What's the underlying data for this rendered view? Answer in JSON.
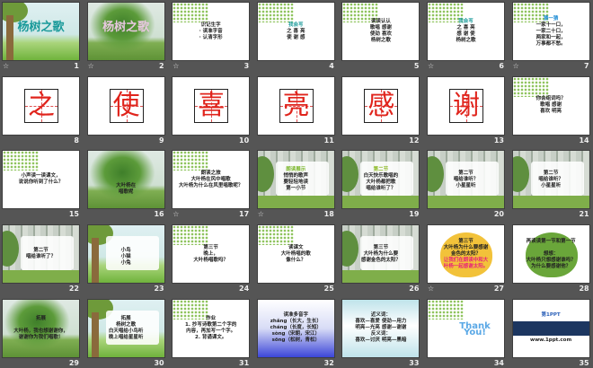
{
  "view": "slide-sorter",
  "slides": [
    {
      "number": "1",
      "theme": "meadow",
      "anim": true,
      "lines": [
        "杨树之歌"
      ],
      "accent": "#1a9a9a"
    },
    {
      "number": "2",
      "theme": "photo",
      "anim": true,
      "lines": [
        "杨树之歌"
      ],
      "accent": "#e8c8e0"
    },
    {
      "number": "3",
      "theme": "vines",
      "anim": true,
      "lines": [
        "识记生字",
        "· 读准字音",
        "· 认清字形"
      ]
    },
    {
      "number": "4",
      "theme": "vines",
      "anim": false,
      "lines": [
        "我会写",
        "之 喜 亮",
        "使 谢 感"
      ],
      "accent": "#1a9a9a"
    },
    {
      "number": "5",
      "theme": "vines",
      "anim": false,
      "lines": [
        "读读认认",
        "歌唱 感谢",
        "使劲 喜欢",
        "杨树之歌"
      ]
    },
    {
      "number": "6",
      "theme": "vines",
      "anim": true,
      "lines": [
        "我会写",
        "之 喜 亮",
        "感 谢 使",
        "杨树之歌"
      ],
      "accent": "#1a9a9a"
    },
    {
      "number": "7",
      "theme": "vines",
      "anim": true,
      "lines": [
        "猜一猜",
        "一家十一口，",
        "一家二十口，",
        "两家和一起，",
        "万事都不愁。"
      ],
      "accent": "#1a8ad4"
    },
    {
      "number": "8",
      "theme": "char",
      "anim": false,
      "char": "之"
    },
    {
      "number": "9",
      "theme": "char",
      "anim": false,
      "char": "使"
    },
    {
      "number": "10",
      "theme": "char",
      "anim": false,
      "char": "喜"
    },
    {
      "number": "11",
      "theme": "char",
      "anim": false,
      "char": "亮"
    },
    {
      "number": "12",
      "theme": "char",
      "anim": false,
      "char": "感"
    },
    {
      "number": "13",
      "theme": "char",
      "anim": false,
      "char": "谢"
    },
    {
      "number": "14",
      "theme": "vines",
      "anim": false,
      "lines": [
        "你会组词吗？",
        "歌唱 感谢",
        "喜欢 明亮"
      ]
    },
    {
      "number": "15",
      "theme": "vines",
      "anim": false,
      "lines": [
        "小声读一读课文，",
        "说说你听到了什么？"
      ]
    },
    {
      "number": "16",
      "theme": "photo",
      "anim": false,
      "lines": [
        "",
        "",
        "",
        "大叶杨在",
        "唱歌呢"
      ]
    },
    {
      "number": "17",
      "theme": "vines",
      "anim": true,
      "lines": [
        "朗读之旅",
        "大叶杨在风中唱歌",
        "大叶杨为什么在风里唱歌呢？"
      ]
    },
    {
      "number": "18",
      "theme": "forest",
      "anim": true,
      "lines": [
        "朗读展示",
        "悄悄的歌声",
        "要轻轻地读",
        "第一小节"
      ],
      "accent": "#7ab62a"
    },
    {
      "number": "19",
      "theme": "forest",
      "anim": false,
      "lines": [
        "第二节",
        "白天快乐歌唱的",
        "大叶杨都把歌",
        "唱给谁听了？"
      ],
      "accent": "#8ab820"
    },
    {
      "number": "20",
      "theme": "forest",
      "anim": false,
      "lines": [
        "第二节",
        "唱给谁听？",
        "小星星听"
      ]
    },
    {
      "number": "21",
      "theme": "forest",
      "anim": false,
      "lines": [
        "第二节",
        "唱给谁听？",
        "小星星听"
      ]
    },
    {
      "number": "22",
      "theme": "forest",
      "anim": false,
      "lines": [
        "第二节",
        "唱给谁听了？"
      ]
    },
    {
      "number": "23",
      "theme": "meadow",
      "anim": false,
      "lines": [
        "",
        "小鸟",
        "小猫",
        "小兔"
      ]
    },
    {
      "number": "24",
      "theme": "vines",
      "anim": false,
      "lines": [
        "第三节",
        "晚上，",
        "大叶杨唱歌吗？"
      ]
    },
    {
      "number": "25",
      "theme": "vines",
      "anim": false,
      "lines": [
        "读课文",
        "大叶杨唱的歌",
        "像什么？"
      ]
    },
    {
      "number": "26",
      "theme": "forest",
      "anim": false,
      "lines": [
        "第三节",
        "大叶杨为什么要",
        "感谢金色的太阳？"
      ]
    },
    {
      "number": "27",
      "theme": "leaf",
      "anim": true,
      "lines": [
        "第三节",
        "大叶杨为什么要感谢",
        "金色的太阳？",
        "让我们在朗读中和大",
        "叶杨一起感谢太阳。"
      ]
    },
    {
      "number": "28",
      "theme": "leaf",
      "leafColor": "green",
      "anim": false,
      "lines": [
        "再读读第一节和第一节",
        "",
        "想想：",
        "大叶杨只想感谢谁吗？",
        "为什么要感谢他？"
      ]
    },
    {
      "number": "29",
      "theme": "photo",
      "anim": false,
      "lines": [
        "拓展",
        "",
        "大叶杨，我也想谢谢你，",
        "谢谢你为我们唱歌！"
      ]
    },
    {
      "number": "30",
      "theme": "meadow",
      "anim": false,
      "lines": [
        "拓展",
        "杨树之歌",
        "白天唱给小鸟听",
        "晚上唱给星星听"
      ]
    },
    {
      "number": "31",
      "theme": "vines",
      "anim": false,
      "lines": [
        "作业",
        "1. 抄写诗歌第二个字的",
        "内容，再加写一个字。",
        "2. 背诵课文。"
      ]
    },
    {
      "number": "32",
      "theme": "blue",
      "anim": false,
      "lines": [
        "读准多音字",
        "zhǎng（长大，生长）",
        "cháng（长度，长短）",
        "sòng（宋朝，宋江）",
        "sōng（松树，青松）"
      ]
    },
    {
      "number": "33",
      "theme": "teal",
      "anim": false,
      "lines": [
        "近义词：",
        "喜欢—喜爱 使劲—用力",
        "明亮—光亮 感谢—谢谢",
        "反义词：",
        "喜欢—讨厌 明亮—黑暗"
      ]
    },
    {
      "number": "34",
      "theme": "vines",
      "anim": false,
      "lines": [
        "Thank You!"
      ],
      "accent": "#5aa8e6"
    },
    {
      "number": "35",
      "theme": "ppt",
      "anim": false,
      "lines": [
        "第1PPT",
        "",
        "",
        "",
        "www.1ppt.com"
      ],
      "accent": "#2a5fb8"
    }
  ]
}
